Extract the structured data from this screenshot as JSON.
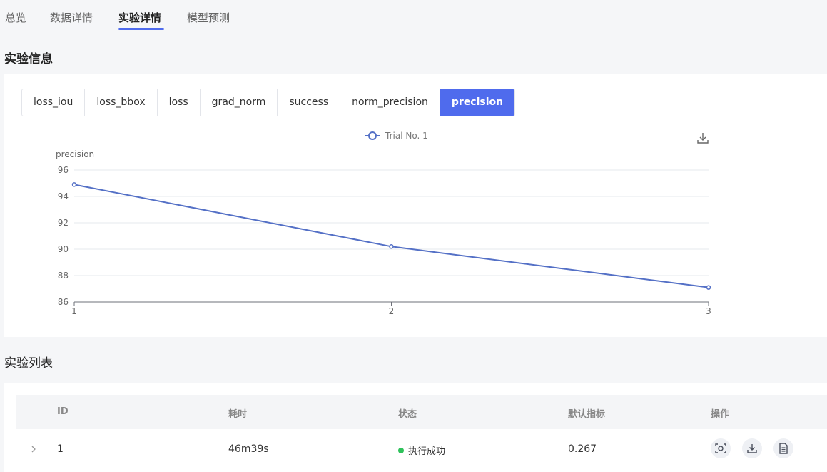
{
  "top_tabs": [
    {
      "label": "总览",
      "active": false
    },
    {
      "label": "数据详情",
      "active": false
    },
    {
      "label": "实验详情",
      "active": true
    },
    {
      "label": "模型预测",
      "active": false
    }
  ],
  "experiment_info": {
    "title": "实验信息",
    "metric_tabs": [
      {
        "label": "loss_iou",
        "active": false
      },
      {
        "label": "loss_bbox",
        "active": false
      },
      {
        "label": "loss",
        "active": false
      },
      {
        "label": "grad_norm",
        "active": false
      },
      {
        "label": "success",
        "active": false
      },
      {
        "label": "norm_precision",
        "active": false
      },
      {
        "label": "precision",
        "active": true
      }
    ],
    "download_icon": "download-icon"
  },
  "chart_data": {
    "type": "line",
    "x": [
      1,
      2,
      3
    ],
    "series": [
      {
        "name": "Trial No. 1",
        "values": [
          94.9,
          90.2,
          87.1
        ]
      }
    ],
    "xlabel": "",
    "ylabel": "precision",
    "ylim": [
      86,
      96
    ],
    "yticks": [
      96,
      94,
      92,
      90,
      88,
      86
    ],
    "xticks": [
      1,
      2,
      3
    ],
    "grid": true,
    "legend_position": "top-center",
    "line_color": "#5470c6"
  },
  "experiment_list": {
    "title": "实验列表",
    "columns": [
      "ID",
      "耗时",
      "状态",
      "默认指标",
      "操作"
    ],
    "rows": [
      {
        "id": "1",
        "duration": "46m39s",
        "status": "执行成功",
        "status_color": "#2fc25b",
        "metric": "0.267"
      }
    ],
    "actions": [
      "screenshot-icon",
      "download-icon",
      "document-icon"
    ]
  },
  "colors": {
    "accent": "#4f6bed",
    "success": "#2fc25b"
  }
}
